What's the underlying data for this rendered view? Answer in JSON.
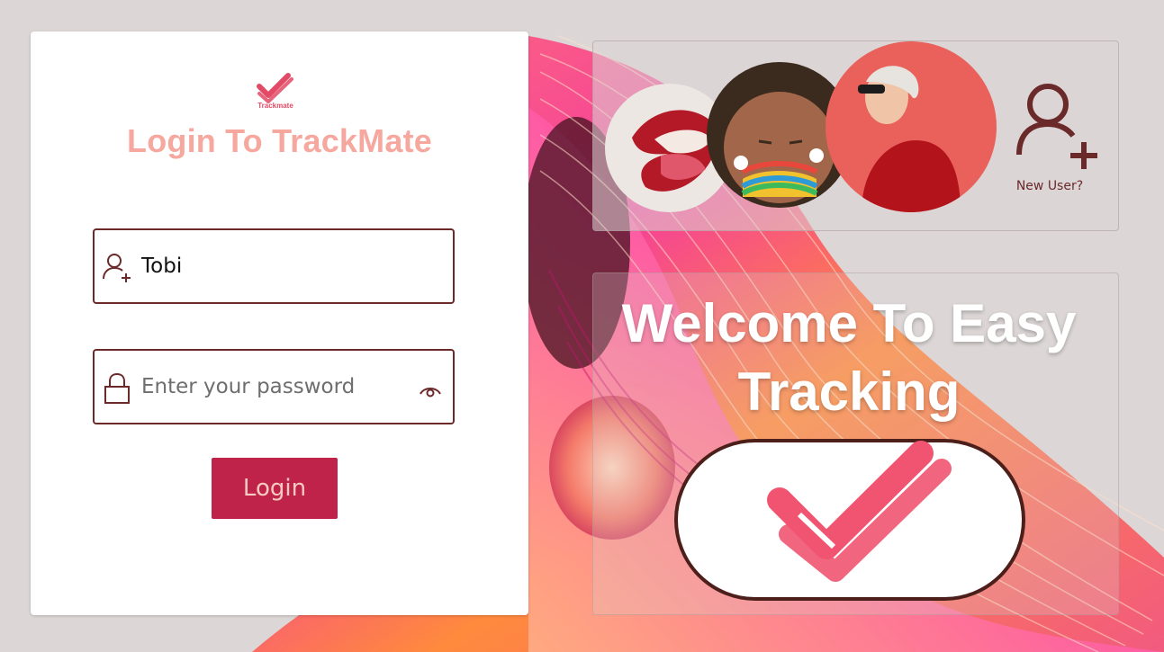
{
  "brand": {
    "logo_caption": "Trackmate",
    "accent": "#e24a66"
  },
  "login": {
    "title": "Login To TrackMate",
    "username_value": "Tobi",
    "password_placeholder": "Enter your password",
    "button_label": "Login",
    "button_color": "#c0234a"
  },
  "right_panel": {
    "new_user_label": "New User?",
    "welcome_line1": "Welcome To Easy",
    "welcome_line2": "Tracking"
  },
  "icons": {
    "username": "user-plus-icon",
    "password": "lock-icon",
    "toggle_password": "eye-icon",
    "new_user": "user-plus-icon",
    "brand": "double-check-icon"
  }
}
